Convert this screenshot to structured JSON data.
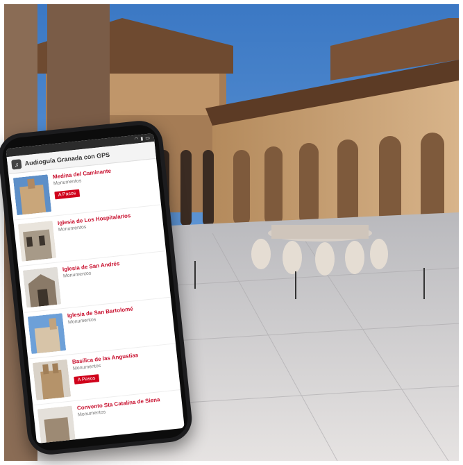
{
  "app": {
    "title": "Audioguía Granada con GPS"
  },
  "status_bar": {
    "icons": [
      "wifi-icon",
      "signal-icon",
      "battery-icon"
    ],
    "time": ""
  },
  "list": [
    {
      "title": "Medina del Caminante",
      "subtitle": "Monumentos",
      "badge": "A Pasos"
    },
    {
      "title": "Iglesia de Los Hospitalarios",
      "subtitle": "Monumentos",
      "badge": ""
    },
    {
      "title": "Iglesia de San Andrés",
      "subtitle": "Monumentos",
      "badge": ""
    },
    {
      "title": "Iglesia de San Bartolomé",
      "subtitle": "Monumentos",
      "badge": ""
    },
    {
      "title": "Basílica de las Angustias",
      "subtitle": "Monumentos",
      "badge": "A Pasos"
    },
    {
      "title": "Convento Sta Catalina de Siena",
      "subtitle": "Monumentos",
      "badge": ""
    }
  ],
  "colors": {
    "accent": "#c8102e",
    "badge": "#d0021b",
    "sky": "#4a86c8",
    "stone": "#c9a67a"
  }
}
